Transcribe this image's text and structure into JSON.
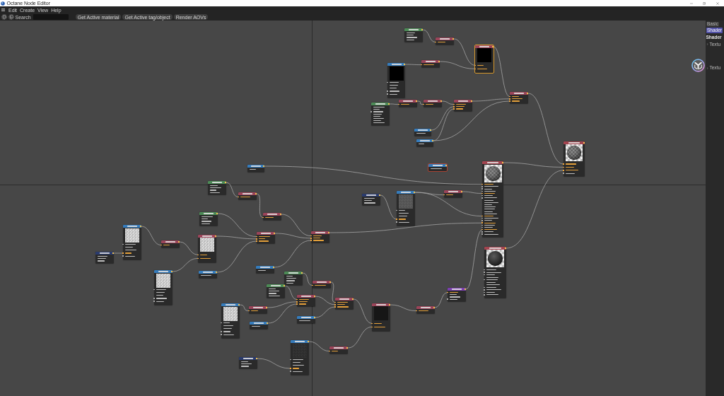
{
  "window": {
    "title": "Octane Node Editor"
  },
  "menu": [
    "Edit",
    "Create",
    "View",
    "Help"
  ],
  "toolbar": {
    "search_label": "Search",
    "buttons": [
      "Get Active material",
      "Get Active tag/object",
      "Render AOVs"
    ]
  },
  "nodes": [
    {
      "kind": "map",
      "selected": false,
      "flagged": false,
      "ports": [
        {
          "kind": "value",
          "connected": false
        },
        {
          "kind": "value",
          "connected": false
        },
        {
          "kind": "value",
          "connected": false
        },
        {
          "kind": "value",
          "connected": false
        }
      ]
    },
    {
      "kind": "texture",
      "selected": false,
      "flagged": false,
      "ports": [
        {
          "kind": "pin",
          "connected": true
        }
      ]
    },
    {
      "kind": "input",
      "selected": false,
      "flagged": false,
      "ports": [
        {
          "kind": "pin",
          "connected": false
        },
        {
          "kind": "value",
          "connected": false
        },
        {
          "kind": "value",
          "connected": false
        },
        {
          "kind": "pin",
          "connected": false
        },
        {
          "kind": "pin",
          "connected": false
        }
      ]
    },
    {
      "kind": "texture",
      "selected": false,
      "flagged": false,
      "ports": [
        {
          "kind": "pin",
          "connected": true
        }
      ]
    },
    {
      "kind": "texture",
      "selected": true,
      "flagged": false,
      "ports": [
        {
          "kind": "pin",
          "connected": true
        },
        {
          "kind": "pin",
          "connected": true
        }
      ]
    },
    {
      "kind": "texture",
      "selected": false,
      "flagged": false,
      "ports": [
        {
          "kind": "pin",
          "connected": true
        },
        {
          "kind": "pin",
          "connected": true
        },
        {
          "kind": "pin",
          "connected": true
        }
      ]
    },
    {
      "kind": "map",
      "selected": false,
      "flagged": false,
      "ports": [
        {
          "kind": "value",
          "connected": false
        },
        {
          "kind": "value",
          "connected": false
        },
        {
          "kind": "pin",
          "connected": false
        },
        {
          "kind": "value",
          "connected": false
        },
        {
          "kind": "value",
          "connected": false
        },
        {
          "kind": "value",
          "connected": false
        },
        {
          "kind": "value",
          "connected": false
        },
        {
          "kind": "value",
          "connected": false
        }
      ]
    },
    {
      "kind": "texture",
      "selected": false,
      "flagged": false,
      "ports": [
        {
          "kind": "pin",
          "connected": true
        }
      ]
    },
    {
      "kind": "texture",
      "selected": false,
      "flagged": false,
      "ports": [
        {
          "kind": "pin",
          "connected": true
        }
      ]
    },
    {
      "kind": "texture",
      "selected": false,
      "flagged": false,
      "ports": [
        {
          "kind": "pin",
          "connected": true
        },
        {
          "kind": "pin",
          "connected": true
        },
        {
          "kind": "pin",
          "connected": true
        }
      ]
    },
    {
      "kind": "input",
      "selected": false,
      "flagged": false,
      "ports": [
        {
          "kind": "value",
          "connected": false
        }
      ]
    },
    {
      "kind": "input",
      "selected": false,
      "flagged": false,
      "ports": [
        {
          "kind": "value",
          "connected": false
        }
      ]
    },
    {
      "kind": "input",
      "selected": false,
      "flagged": false,
      "ports": [
        {
          "kind": "value",
          "connected": false
        }
      ]
    },
    {
      "kind": "input",
      "selected": false,
      "flagged": true,
      "ports": [
        {
          "kind": "value",
          "connected": false
        }
      ]
    },
    {
      "kind": "material",
      "selected": false,
      "flagged": false,
      "ports": [
        {
          "kind": "pin",
          "connected": true
        },
        {
          "kind": "pin",
          "connected": true
        },
        {
          "kind": "pin",
          "connected": true
        },
        {
          "kind": "pin",
          "connected": false
        }
      ]
    },
    {
      "kind": "map",
      "selected": false,
      "flagged": false,
      "ports": [
        {
          "kind": "value",
          "connected": false
        },
        {
          "kind": "value",
          "connected": false
        },
        {
          "kind": "value",
          "connected": false
        },
        {
          "kind": "value",
          "connected": false
        }
      ]
    },
    {
      "kind": "texture",
      "selected": false,
      "flagged": false,
      "ports": [
        {
          "kind": "pin",
          "connected": true
        }
      ]
    },
    {
      "kind": "transform",
      "selected": false,
      "flagged": false,
      "ports": [
        {
          "kind": "value",
          "connected": false
        },
        {
          "kind": "value",
          "connected": false
        },
        {
          "kind": "value",
          "connected": false
        }
      ]
    },
    {
      "kind": "input",
      "selected": false,
      "flagged": false,
      "ports": [
        {
          "kind": "pin",
          "connected": false
        },
        {
          "kind": "value",
          "connected": false
        },
        {
          "kind": "value",
          "connected": false
        },
        {
          "kind": "pin",
          "connected": true
        },
        {
          "kind": "pin",
          "connected": false
        }
      ]
    },
    {
      "kind": "texture",
      "selected": false,
      "flagged": false,
      "ports": [
        {
          "kind": "pin",
          "connected": true
        }
      ]
    },
    {
      "kind": "map",
      "selected": false,
      "flagged": false,
      "ports": [
        {
          "kind": "value",
          "connected": false
        },
        {
          "kind": "value",
          "connected": false
        },
        {
          "kind": "value",
          "connected": false
        },
        {
          "kind": "value",
          "connected": false
        }
      ]
    },
    {
      "kind": "texture",
      "selected": false,
      "flagged": false,
      "ports": [
        {
          "kind": "pin",
          "connected": true
        }
      ]
    },
    {
      "kind": "material",
      "selected": false,
      "flagged": false,
      "ports": [
        {
          "kind": "pin",
          "connected": true
        },
        {
          "kind": "pin",
          "connected": false
        },
        {
          "kind": "pin",
          "connected": false
        },
        {
          "kind": "pin",
          "connected": false
        },
        {
          "kind": "pin",
          "connected": true
        },
        {
          "kind": "pin",
          "connected": false
        },
        {
          "kind": "pin",
          "connected": false
        },
        {
          "kind": "value",
          "connected": false
        },
        {
          "kind": "value",
          "connected": false
        },
        {
          "kind": "value",
          "connected": false
        },
        {
          "kind": "value",
          "connected": false
        },
        {
          "kind": "value",
          "connected": false
        },
        {
          "kind": "value",
          "connected": false
        },
        {
          "kind": "value",
          "connected": false
        },
        {
          "kind": "pin",
          "connected": true
        },
        {
          "kind": "pin",
          "connected": false
        },
        {
          "kind": "pin",
          "connected": false
        },
        {
          "kind": "pin",
          "connected": true
        },
        {
          "kind": "pin",
          "connected": false
        },
        {
          "kind": "pin",
          "connected": false
        },
        {
          "kind": "pin",
          "connected": true
        },
        {
          "kind": "pin",
          "connected": false
        },
        {
          "kind": "pin",
          "connected": false
        }
      ]
    },
    {
      "kind": "transform",
      "selected": false,
      "flagged": false,
      "ports": [
        {
          "kind": "value",
          "connected": false
        },
        {
          "kind": "value",
          "connected": false
        },
        {
          "kind": "value",
          "connected": false
        }
      ]
    },
    {
      "kind": "input",
      "selected": false,
      "flagged": false,
      "ports": [
        {
          "kind": "pin",
          "connected": false
        },
        {
          "kind": "value",
          "connected": false
        },
        {
          "kind": "value",
          "connected": false
        },
        {
          "kind": "pin",
          "connected": true
        },
        {
          "kind": "pin",
          "connected": false
        }
      ]
    },
    {
      "kind": "texture",
      "selected": false,
      "flagged": false,
      "ports": [
        {
          "kind": "pin",
          "connected": true
        }
      ]
    },
    {
      "kind": "texture",
      "selected": false,
      "flagged": false,
      "ports": [
        {
          "kind": "pin",
          "connected": true
        },
        {
          "kind": "pin",
          "connected": true
        }
      ]
    },
    {
      "kind": "texture",
      "selected": false,
      "flagged": false,
      "ports": [
        {
          "kind": "pin",
          "connected": true
        },
        {
          "kind": "pin",
          "connected": true
        },
        {
          "kind": "pin",
          "connected": true
        }
      ]
    },
    {
      "kind": "texture",
      "selected": false,
      "flagged": false,
      "ports": [
        {
          "kind": "pin",
          "connected": true
        },
        {
          "kind": "pin",
          "connected": true
        },
        {
          "kind": "pin",
          "connected": true
        }
      ]
    },
    {
      "kind": "input",
      "selected": false,
      "flagged": false,
      "ports": [
        {
          "kind": "value",
          "connected": false
        }
      ]
    },
    {
      "kind": "input",
      "selected": false,
      "flagged": false,
      "ports": [
        {
          "kind": "pin",
          "connected": false
        },
        {
          "kind": "value",
          "connected": false
        },
        {
          "kind": "value",
          "connected": false
        },
        {
          "kind": "pin",
          "connected": false
        },
        {
          "kind": "pin",
          "connected": false
        }
      ]
    },
    {
      "kind": "input",
      "selected": false,
      "flagged": false,
      "ports": [
        {
          "kind": "value",
          "connected": false
        }
      ]
    },
    {
      "kind": "map",
      "selected": false,
      "flagged": false,
      "ports": [
        {
          "kind": "value",
          "connected": false
        },
        {
          "kind": "value",
          "connected": false
        },
        {
          "kind": "value",
          "connected": false
        },
        {
          "kind": "value",
          "connected": false
        }
      ]
    },
    {
      "kind": "map",
      "selected": false,
      "flagged": false,
      "ports": [
        {
          "kind": "value",
          "connected": false
        },
        {
          "kind": "value",
          "connected": false
        },
        {
          "kind": "value",
          "connected": false
        },
        {
          "kind": "value",
          "connected": false
        }
      ]
    },
    {
      "kind": "texture",
      "selected": false,
      "flagged": false,
      "ports": [
        {
          "kind": "pin",
          "connected": true
        }
      ]
    },
    {
      "kind": "emission",
      "selected": false,
      "flagged": false,
      "ports": [
        {
          "kind": "pin",
          "connected": true
        },
        {
          "kind": "value",
          "connected": false
        },
        {
          "kind": "value",
          "connected": false
        },
        {
          "kind": "pin",
          "connected": false
        }
      ]
    },
    {
      "kind": "material",
      "selected": false,
      "flagged": false,
      "ports": [
        {
          "kind": "pin",
          "connected": false
        },
        {
          "kind": "pin",
          "connected": false
        },
        {
          "kind": "pin",
          "connected": false
        },
        {
          "kind": "value",
          "connected": false
        },
        {
          "kind": "pin",
          "connected": false
        },
        {
          "kind": "value",
          "connected": false
        },
        {
          "kind": "value",
          "connected": false
        },
        {
          "kind": "pin",
          "connected": false
        },
        {
          "kind": "pin",
          "connected": false
        },
        {
          "kind": "pin",
          "connected": false
        },
        {
          "kind": "pin",
          "connected": false
        }
      ]
    },
    {
      "kind": "texture",
      "selected": false,
      "flagged": false,
      "ports": [
        {
          "kind": "pin",
          "connected": true
        },
        {
          "kind": "pin",
          "connected": true
        },
        {
          "kind": "pin",
          "connected": true
        }
      ]
    },
    {
      "kind": "texture",
      "selected": false,
      "flagged": false,
      "ports": [
        {
          "kind": "pin",
          "connected": true
        },
        {
          "kind": "pin",
          "connected": true
        },
        {
          "kind": "pin",
          "connected": true
        }
      ]
    },
    {
      "kind": "input",
      "selected": false,
      "flagged": false,
      "ports": [
        {
          "kind": "pin",
          "connected": false
        },
        {
          "kind": "value",
          "connected": false
        },
        {
          "kind": "value",
          "connected": false
        },
        {
          "kind": "pin",
          "connected": false
        },
        {
          "kind": "pin",
          "connected": false
        }
      ]
    },
    {
      "kind": "texture",
      "selected": false,
      "flagged": false,
      "ports": [
        {
          "kind": "pin",
          "connected": true
        }
      ]
    },
    {
      "kind": "input",
      "selected": false,
      "flagged": false,
      "ports": [
        {
          "kind": "value",
          "connected": false
        }
      ]
    },
    {
      "kind": "input",
      "selected": false,
      "flagged": false,
      "ports": [
        {
          "kind": "value",
          "connected": false
        }
      ]
    },
    {
      "kind": "texture",
      "selected": false,
      "flagged": false,
      "ports": [
        {
          "kind": "pin",
          "connected": true
        },
        {
          "kind": "pin",
          "connected": true
        }
      ]
    },
    {
      "kind": "texture",
      "selected": false,
      "flagged": false,
      "ports": [
        {
          "kind": "pin",
          "connected": true
        }
      ]
    },
    {
      "kind": "input",
      "selected": false,
      "flagged": false,
      "ports": [
        {
          "kind": "pin",
          "connected": false
        },
        {
          "kind": "value",
          "connected": false
        },
        {
          "kind": "value",
          "connected": false
        },
        {
          "kind": "pin",
          "connected": true
        },
        {
          "kind": "pin",
          "connected": false
        }
      ]
    },
    {
      "kind": "texture",
      "selected": false,
      "flagged": false,
      "ports": [
        {
          "kind": "pin",
          "connected": true
        }
      ]
    },
    {
      "kind": "transform",
      "selected": false,
      "flagged": false,
      "ports": [
        {
          "kind": "value",
          "connected": false
        },
        {
          "kind": "value",
          "connected": false
        },
        {
          "kind": "value",
          "connected": false
        }
      ]
    }
  ],
  "side_panel": {
    "tabs": [
      {
        "label": "Basic",
        "selected": false
      },
      {
        "label": "Shader",
        "selected": true
      }
    ],
    "heading": "Shader",
    "items": [
      {
        "label": "Textu",
        "expanded": false
      },
      {
        "label": "Textu",
        "expanded": false
      }
    ]
  }
}
